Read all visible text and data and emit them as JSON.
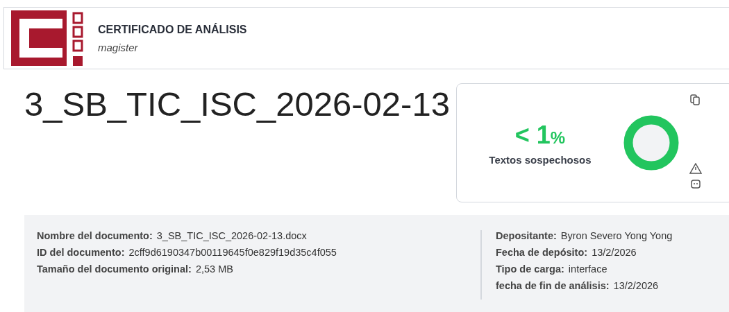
{
  "header": {
    "title": "CERTIFICADO DE ANÁLISIS",
    "subtitle": "magister"
  },
  "document_title": "3_SB_TIC_ISC_2026-02-13",
  "score": {
    "value": "< 1",
    "unit": "%",
    "label": "Textos sospechosos"
  },
  "details_left": [
    {
      "label": "Nombre del documento:",
      "value": "3_SB_TIC_ISC_2026-02-13.docx"
    },
    {
      "label": "ID del documento:",
      "value": "2cff9d6190347b00119645f0e829f19d35c4f055"
    },
    {
      "label": "Tamaño del documento original:",
      "value": "2,53 MB"
    }
  ],
  "details_right": [
    {
      "label": "Depositante:",
      "value": "Byron Severo Yong Yong"
    },
    {
      "label": "Fecha de depósito:",
      "value": "13/2/2026"
    },
    {
      "label": "Tipo de carga:",
      "value": "interface"
    },
    {
      "label": "fecha de fin de análisis:",
      "value": "13/2/2026"
    }
  ]
}
